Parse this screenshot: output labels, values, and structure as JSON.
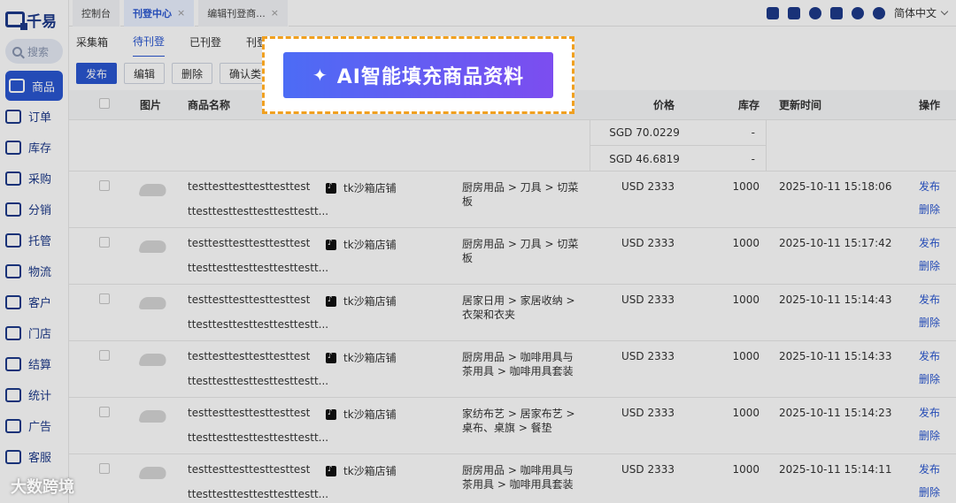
{
  "app": {
    "logo": "千易"
  },
  "sidebar": {
    "search_placeholder": "搜索",
    "items": [
      {
        "label": "商品",
        "icon": "box-icon",
        "active": true
      },
      {
        "label": "订单",
        "icon": "order-icon"
      },
      {
        "label": "库存",
        "icon": "warehouse-icon"
      },
      {
        "label": "采购",
        "icon": "cart-icon"
      },
      {
        "label": "分销",
        "icon": "network-icon"
      },
      {
        "label": "托管",
        "icon": "hosting-icon"
      },
      {
        "label": "物流",
        "icon": "truck-icon"
      },
      {
        "label": "客户",
        "icon": "user-icon"
      },
      {
        "label": "门店",
        "icon": "location-icon"
      },
      {
        "label": "结算",
        "icon": "settle-icon"
      },
      {
        "label": "统计",
        "icon": "chart-icon"
      },
      {
        "label": "广告",
        "icon": "ad-icon"
      },
      {
        "label": "客服",
        "icon": "headset-icon"
      }
    ]
  },
  "topbar": {
    "tabs": [
      {
        "label": "控制台"
      },
      {
        "label": "刊登中心",
        "active": true
      },
      {
        "label": "编辑刊登商..."
      }
    ],
    "language": "简体中文"
  },
  "subtabs": [
    "采集箱",
    "待刊登",
    "已刊登",
    "刊登"
  ],
  "toolbar": {
    "publish": "发布",
    "edit": "编辑",
    "delete": "删除",
    "confirm_category": "确认类目"
  },
  "table": {
    "headers": {
      "image": "图片",
      "name": "商品名称",
      "price": "价格",
      "stock": "库存",
      "updated": "更新时间",
      "actions": "操作"
    },
    "variants": [
      {
        "price": "SGD 70.0229",
        "stock": "-"
      },
      {
        "price": "SGD 46.6819",
        "stock": "-"
      }
    ],
    "rows": [
      {
        "name1": "testtesttesttesttesttest",
        "name2": "ttesttesttesttesttesttestt...",
        "shop": "tk沙箱店铺",
        "category": "厨房用品 > 刀具 > 切菜板",
        "price": "USD 2333",
        "stock": "1000",
        "updated": "2025-10-11 15:18:06",
        "publish": "发布",
        "delete": "删除"
      },
      {
        "name1": "testtesttesttesttesttest",
        "name2": "ttesttesttesttesttesttestt...",
        "shop": "tk沙箱店铺",
        "category": "厨房用品 > 刀具 > 切菜板",
        "price": "USD 2333",
        "stock": "1000",
        "updated": "2025-10-11 15:17:42",
        "publish": "发布",
        "delete": "删除"
      },
      {
        "name1": "testtesttesttesttesttest",
        "name2": "ttesttesttesttesttesttestt...",
        "shop": "tk沙箱店铺",
        "category": "居家日用 > 家居收纳 > 衣架和衣夹",
        "price": "USD 2333",
        "stock": "1000",
        "updated": "2025-10-11 15:14:43",
        "publish": "发布",
        "delete": "删除"
      },
      {
        "name1": "testtesttesttesttesttest",
        "name2": "ttesttesttesttesttesttestt...",
        "shop": "tk沙箱店铺",
        "category": "厨房用品 > 咖啡用具与茶用具 > 咖啡用具套装",
        "price": "USD 2333",
        "stock": "1000",
        "updated": "2025-10-11 15:14:33",
        "publish": "发布",
        "delete": "删除"
      },
      {
        "name1": "testtesttesttesttesttest",
        "name2": "ttesttesttesttesttesttestt...",
        "shop": "tk沙箱店铺",
        "category": "家纺布艺 > 居家布艺 > 桌布、桌旗 > 餐垫",
        "price": "USD 2333",
        "stock": "1000",
        "updated": "2025-10-11 15:14:23",
        "publish": "发布",
        "delete": "删除"
      },
      {
        "name1": "testtesttesttesttesttest",
        "name2": "ttesttesttesttesttesttestt...",
        "shop": "tk沙箱店铺",
        "category": "厨房用品 > 咖啡用具与茶用具 > 咖啡用具套装",
        "price": "USD 2333",
        "stock": "1000",
        "updated": "2025-10-11 15:14:11",
        "publish": "发布",
        "delete": "删除"
      }
    ]
  },
  "ai_button": {
    "label": "AI智能填充商品资料",
    "icon": "sparkle-icon"
  },
  "watermark": "大数跨境",
  "colors": {
    "primary": "#2a57d1",
    "highlight_border": "#f0a020",
    "ai_gradient_start": "#4c6cf5",
    "ai_gradient_end": "#7c4df0"
  }
}
